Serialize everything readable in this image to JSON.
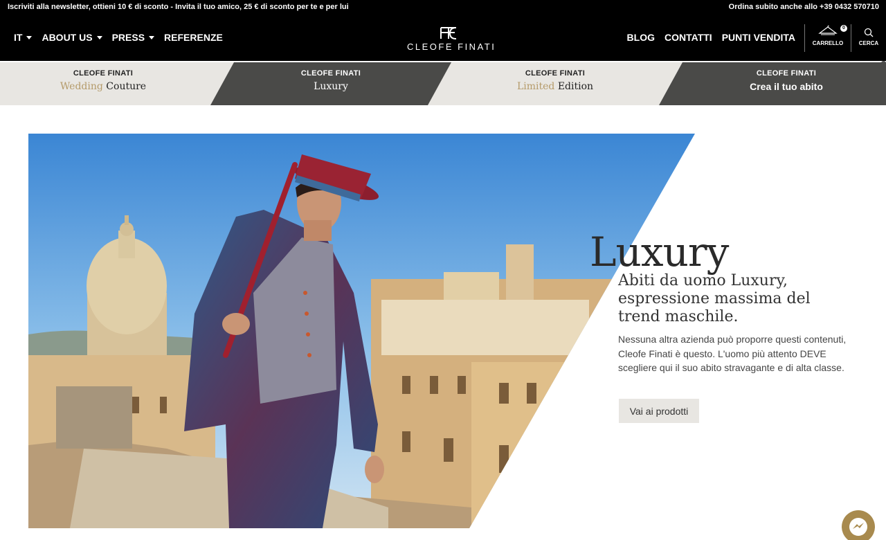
{
  "topbar": {
    "promo": "Iscriviti alla newsletter, ottieni 10 € di sconto - Invita il tuo amico, 25 € di sconto per te e per lui",
    "phone": "Ordina subito anche allo +39 0432 570710"
  },
  "nav": {
    "left": [
      {
        "label": "IT",
        "dropdown": true
      },
      {
        "label": "ABOUT US",
        "dropdown": true
      },
      {
        "label": "PRESS",
        "dropdown": true
      },
      {
        "label": "REFERENZE",
        "dropdown": false
      }
    ],
    "logo_text": "CLEOFE FINATI",
    "right": [
      "BLOG",
      "CONTATTI",
      "PUNTI VENDITA"
    ],
    "cart_label": "CARRELLO",
    "cart_count": "0",
    "search_label": "CERCA"
  },
  "categories": [
    {
      "brand": "CLEOFE FINATI",
      "accent": "Wedding",
      "rest": "Couture"
    },
    {
      "brand": "CLEOFE FINATI",
      "accent": "",
      "rest": "Luxury"
    },
    {
      "brand": "CLEOFE FINATI",
      "accent": "Limited",
      "rest": "Edition"
    },
    {
      "brand": "CLEOFE FINATI",
      "accent": "",
      "rest": "Crea il tuo abito"
    }
  ],
  "hero": {
    "title": "Luxury",
    "subtitle": "Abiti da uomo Luxury, espressione massima del trend maschile.",
    "body": "Nessuna altra azienda può proporre questi contenuti, Cleofe Finati è questo. L'uomo più attento DEVE scegliere qui il suo abito stravagante e di alta classe.",
    "cta": "Vai ai prodotti"
  },
  "colors": {
    "nav_bg": "#000000",
    "strip_light": "#e8e6e2",
    "strip_dark": "#4a4a48",
    "gold_accent": "#b59b6a"
  }
}
